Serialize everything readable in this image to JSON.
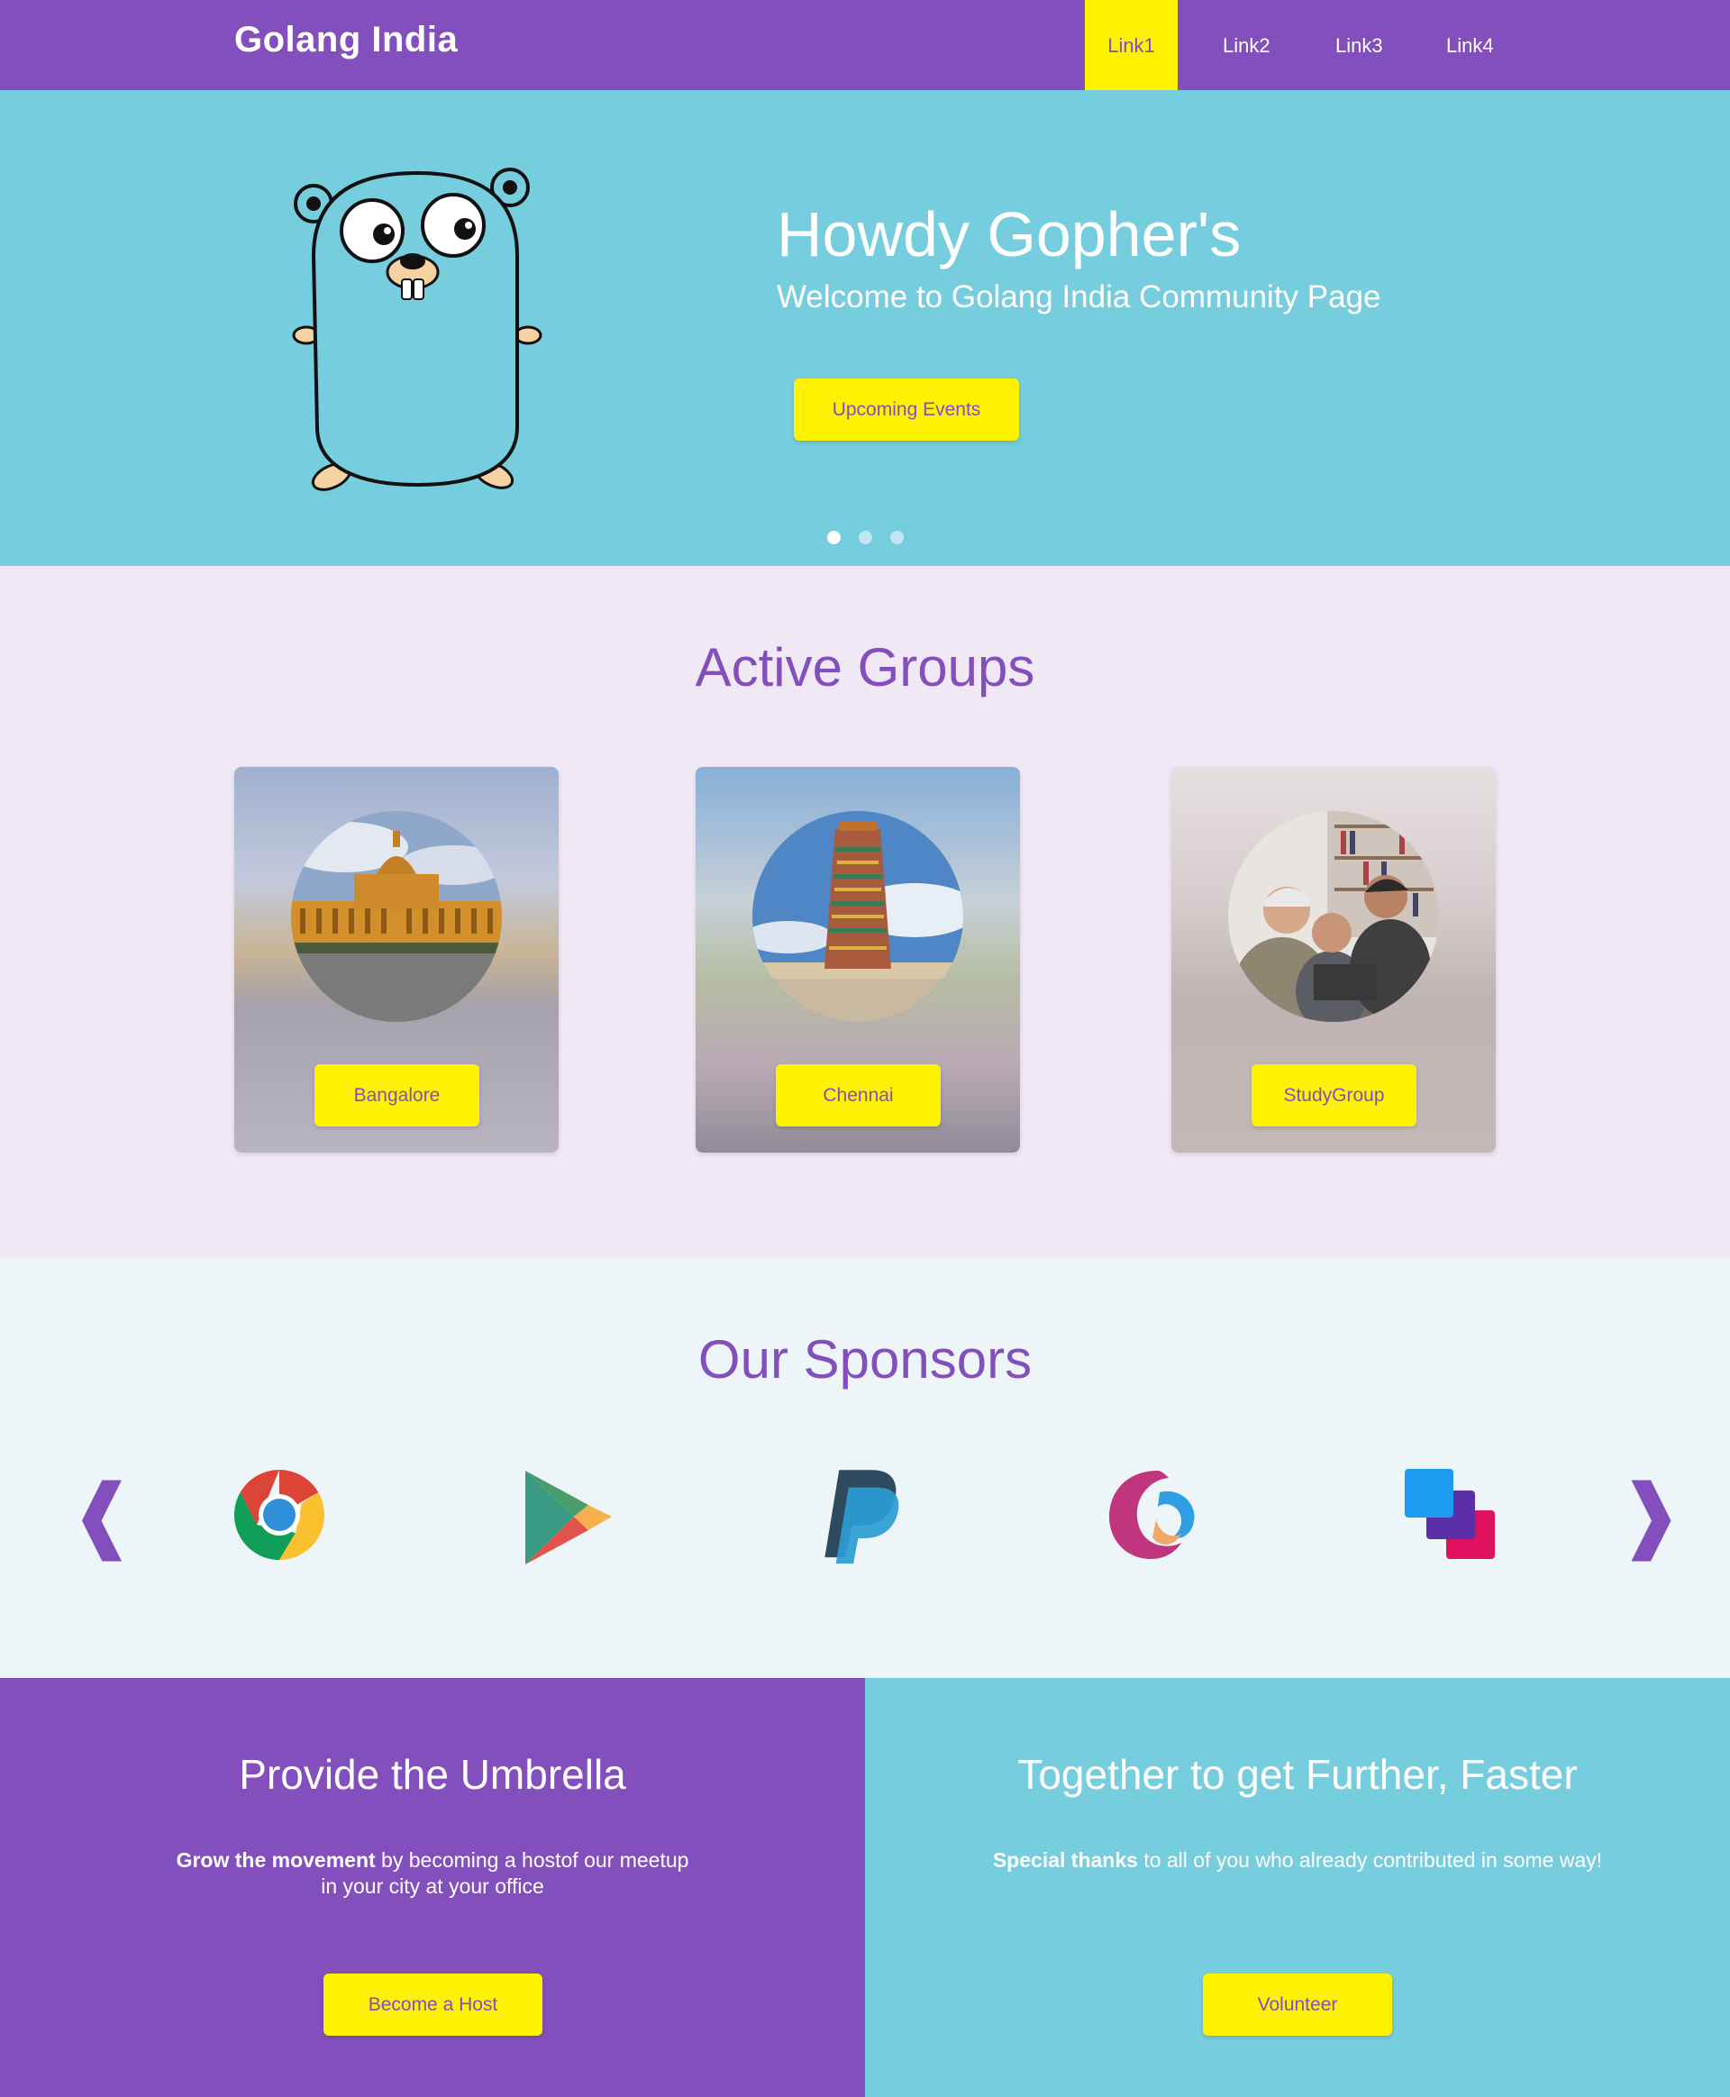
{
  "navbar": {
    "brand": "Golang India",
    "links": [
      "Link1",
      "Link2",
      "Link3",
      "Link4"
    ],
    "active_link": "Link1"
  },
  "hero": {
    "title": "Howdy Gopher's",
    "subtitle": "Welcome to Golang India Community Page",
    "button_label": "Upcoming Events",
    "slide_count": 3,
    "active_slide": 1
  },
  "groups": {
    "title": "Active Groups",
    "items": [
      {
        "label": "Bangalore",
        "image": "vidhana-soudha-photo"
      },
      {
        "label": "Chennai",
        "image": "meenakshi-temple-photo"
      },
      {
        "label": "StudyGroup",
        "image": "study-group-photo"
      }
    ]
  },
  "sponsors": {
    "title": "Our Sponsors",
    "prev_arrow": "❰",
    "next_arrow": "❱",
    "logos": [
      "chrome-logo",
      "google-play-logo",
      "paypal-logo",
      "swirl-logo",
      "stacked-squares-logo"
    ]
  },
  "host": {
    "title": "Provide the Umbrella",
    "text_bold": "Grow the movement",
    "text_line1": " by becoming a hostof our meetup",
    "text_line2": "in your city at your office",
    "button_label": "Become a Host"
  },
  "volunteer": {
    "title": "Together to get Further, Faster",
    "text_bold": "Special thanks",
    "text_rest": " to all of you who already contributed in some way!",
    "button_label": "Volunteer"
  },
  "colors": {
    "purple": "#834fbd",
    "teal": "#76cddd",
    "yellow": "#fff200",
    "lavender_bg": "#f0e8f4",
    "light_bg": "#eef5f8"
  }
}
